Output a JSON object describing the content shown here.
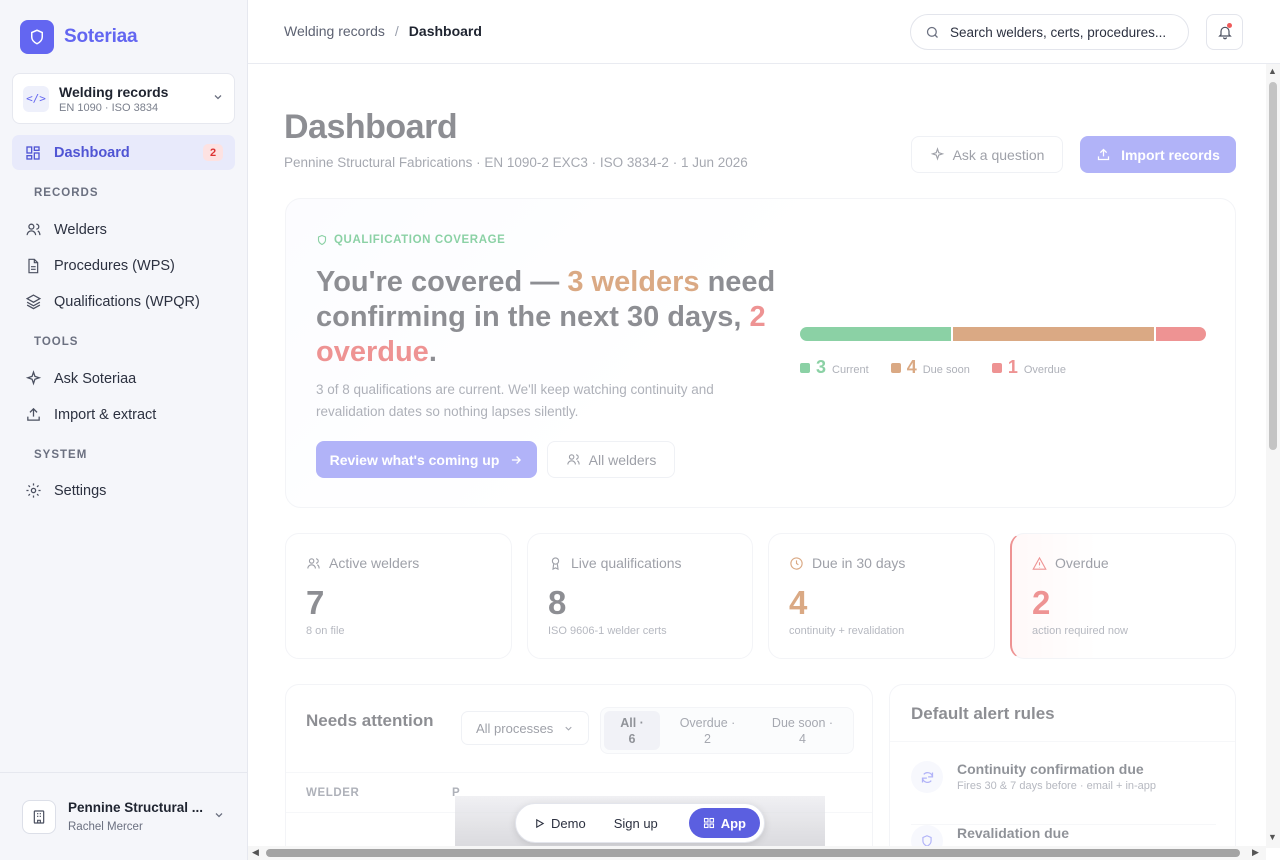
{
  "brand": {
    "name": "Soteriaa"
  },
  "workspace": {
    "title": "Welding records",
    "subtitle": "EN 1090 · ISO 3834"
  },
  "sidebar": {
    "dashboard": {
      "label": "Dashboard",
      "badge": "2"
    },
    "records_label": "RECORDS",
    "records": [
      {
        "label": "Welders",
        "icon": "users-icon"
      },
      {
        "label": "Procedures (WPS)",
        "icon": "document-icon"
      },
      {
        "label": "Qualifications (WPQR)",
        "icon": "layers-icon"
      }
    ],
    "tools_label": "TOOLS",
    "tools": [
      {
        "label": "Ask Soteriaa",
        "icon": "sparkle-icon"
      },
      {
        "label": "Import & extract",
        "icon": "upload-icon"
      }
    ],
    "system_label": "SYSTEM",
    "system": [
      {
        "label": "Settings",
        "icon": "gear-icon"
      }
    ]
  },
  "org": {
    "name": "Pennine Structural ...",
    "user": "Rachel Mercer"
  },
  "topbar": {
    "breadcrumb_parent": "Welding records",
    "breadcrumb_sep": "/",
    "breadcrumb_current": "Dashboard",
    "search_placeholder": "Search welders, certs, procedures..."
  },
  "page": {
    "title": "Dashboard",
    "subtitle": "Pennine Structural Fabrications · EN 1090-2 EXC3 · ISO 3834-2 · 1 Jun 2026",
    "ask_button": "Ask a question",
    "import_button": "Import records"
  },
  "hero": {
    "tag": "QUALIFICATION COVERAGE",
    "head_1": "You're covered — ",
    "head_amber": "3 welders",
    "head_2": " need confirming in the next 30 days, ",
    "head_red": "2 overdue",
    "head_3": ".",
    "description": "3 of 8 qualifications are current. We'll keep watching continuity and revalidation dates so nothing lapses silently.",
    "review_button": "Review what's coming up",
    "all_welders_button": "All welders",
    "legend": [
      {
        "num": "3",
        "label": "Current",
        "color": "#16a34a"
      },
      {
        "num": "4",
        "label": "Due soon",
        "color": "#b45309"
      },
      {
        "num": "1",
        "label": "Overdue",
        "color": "#dc2626"
      }
    ],
    "colors": {
      "current": "#16a34a",
      "due_soon": "#b45309",
      "overdue": "#dc2626"
    }
  },
  "stats": [
    {
      "label": "Active welders",
      "value": "7",
      "sub": "8 on file",
      "icon": "users-icon"
    },
    {
      "label": "Live qualifications",
      "value": "8",
      "sub": "ISO 9606-1 welder certs",
      "icon": "badge-icon"
    },
    {
      "label": "Due in 30 days",
      "value": "4",
      "sub": "continuity + revalidation",
      "icon": "clock-icon"
    },
    {
      "label": "Overdue",
      "value": "2",
      "sub": "action required now",
      "icon": "warning-icon"
    }
  ],
  "needs_attention": {
    "title": "Needs attention",
    "filter": "All processes",
    "tabs": [
      {
        "a": "All ·",
        "b": "6"
      },
      {
        "a": "Overdue ·",
        "b": "2"
      },
      {
        "a": "Due soon ·",
        "b": "4"
      }
    ],
    "columns": [
      "WELDER",
      "P"
    ]
  },
  "alert_rules": {
    "title": "Default alert rules",
    "rules": [
      {
        "title": "Continuity confirmation due",
        "sub": "Fires 30 & 7 days before · email + in-app",
        "icon": "refresh-icon"
      },
      {
        "title": "Revalidation due",
        "sub": "",
        "icon": "shield-icon"
      }
    ]
  },
  "float_nav": {
    "demo": "Demo",
    "signup": "Sign up",
    "app": "App"
  }
}
